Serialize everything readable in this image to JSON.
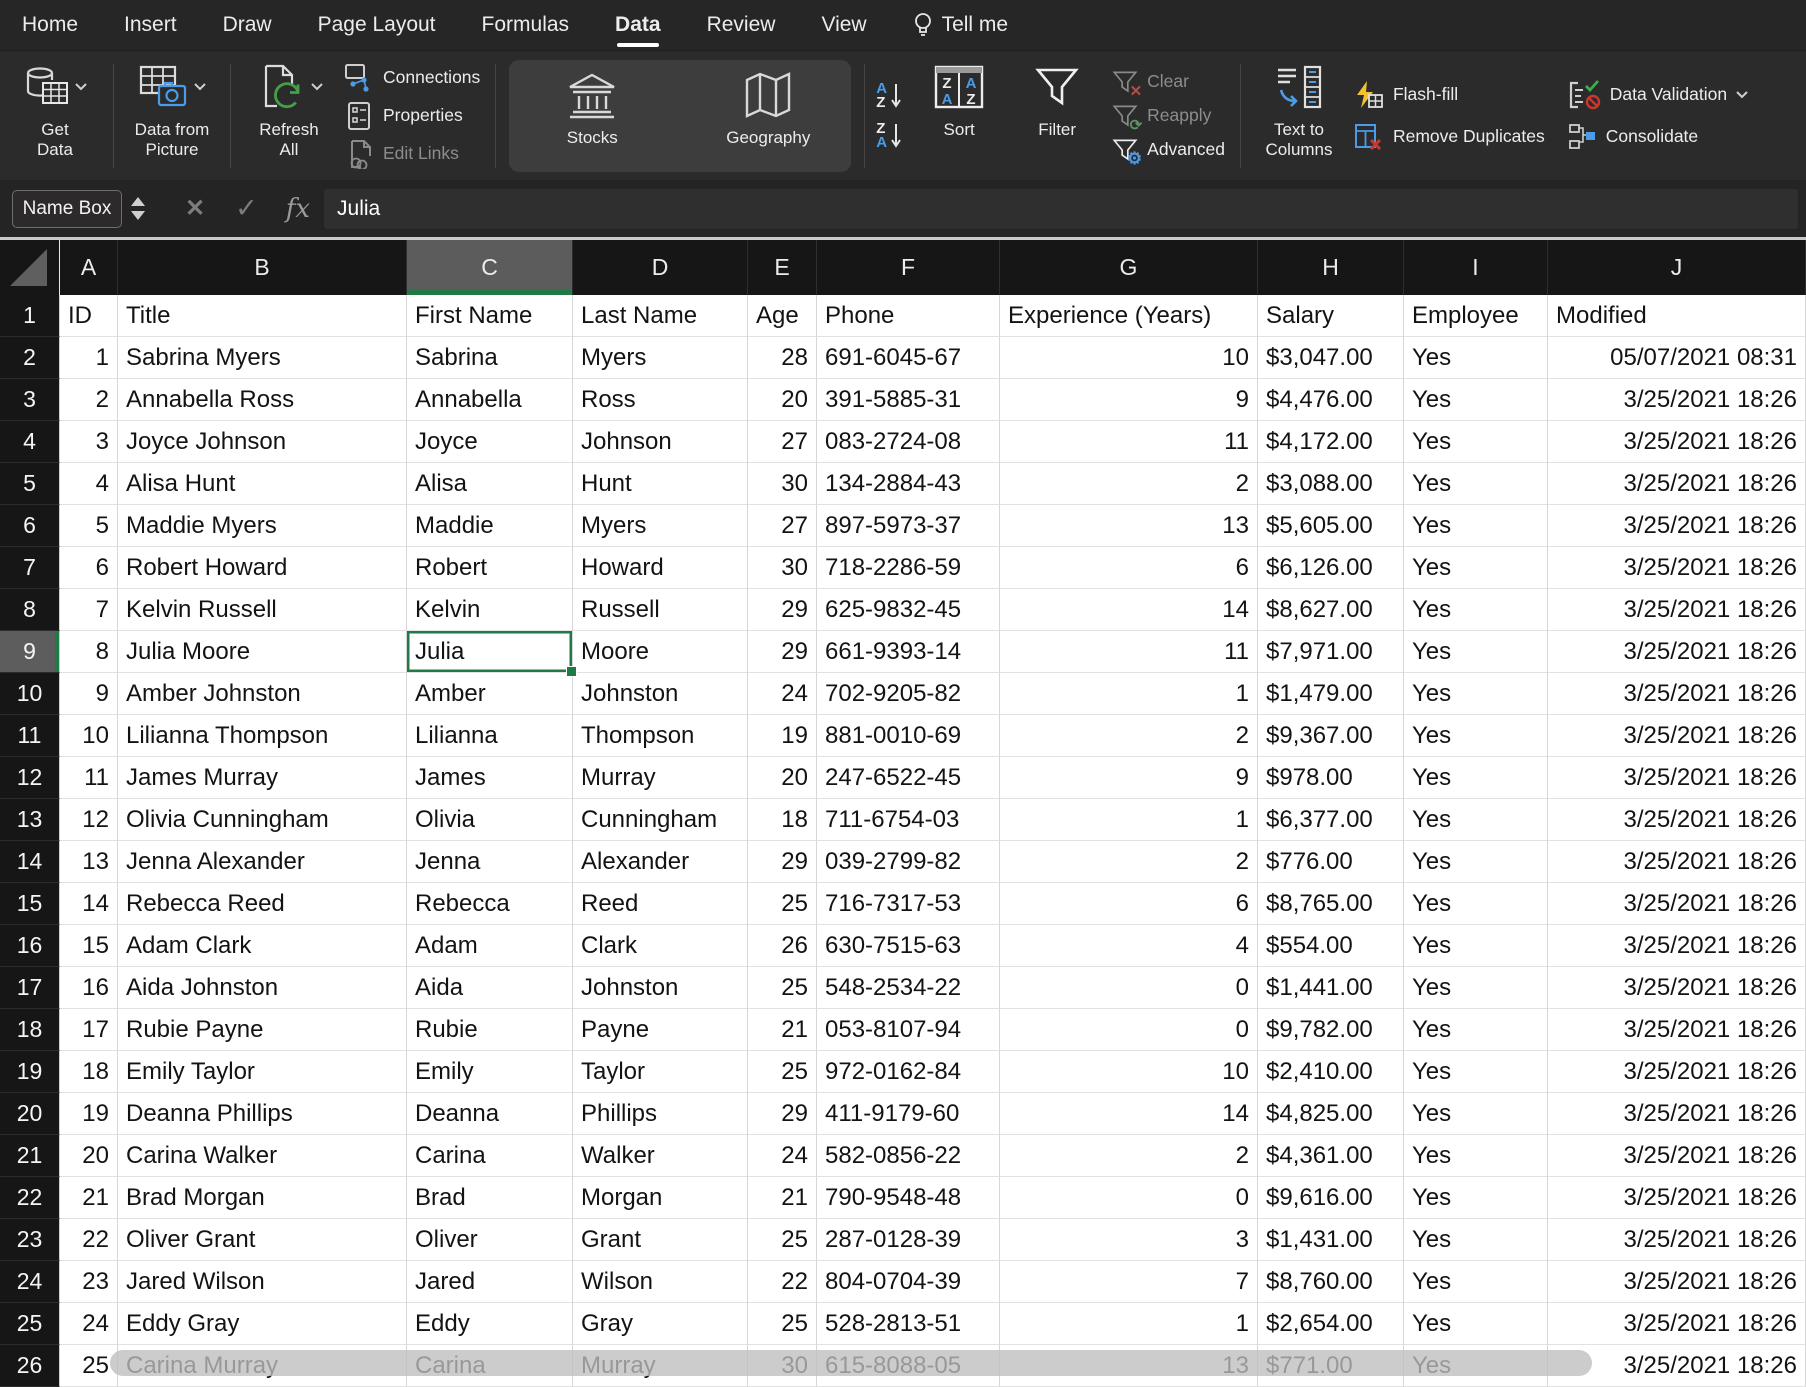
{
  "colors": {
    "accent_green": "#1E7B45",
    "icon_blue": "#4A9BE8",
    "icon_green": "#43A047",
    "icon_red": "#C9382E",
    "icon_yellow": "#F2C12E",
    "header_bg": "#161616",
    "selected_header_bg": "#5C5C5C"
  },
  "menu": {
    "items": [
      {
        "label": "Home"
      },
      {
        "label": "Insert"
      },
      {
        "label": "Draw"
      },
      {
        "label": "Page Layout"
      },
      {
        "label": "Formulas"
      },
      {
        "label": "Data",
        "active": true
      },
      {
        "label": "Review"
      },
      {
        "label": "View"
      },
      {
        "label": "Tell me",
        "icon": "lightbulb"
      }
    ]
  },
  "ribbon": {
    "get_data": "Get\nData",
    "data_from_picture": "Data from\nPicture",
    "refresh_all": "Refresh\nAll",
    "connections": "Connections",
    "properties": "Properties",
    "edit_links": "Edit Links",
    "stocks": "Stocks",
    "geography": "Geography",
    "sort": "Sort",
    "filter": "Filter",
    "clear": "Clear",
    "reapply": "Reapply",
    "advanced": "Advanced",
    "text_to_columns": "Text to\nColumns",
    "flash_fill": "Flash-fill",
    "remove_duplicates": "Remove Duplicates",
    "data_validation": "Data Validation",
    "consolidate": "Consolidate"
  },
  "formula_bar": {
    "name_box": "Name Box",
    "cancel": "✕",
    "confirm": "✓",
    "fx": "fx",
    "value": "Julia"
  },
  "grid": {
    "columns": [
      "A",
      "B",
      "C",
      "D",
      "E",
      "F",
      "G",
      "H",
      "I",
      "J"
    ],
    "field_headers": [
      "ID",
      "Title",
      "First Name",
      "Last Name",
      "Age",
      "Phone",
      "Experience (Years)",
      "Salary",
      "Employee",
      "Modified"
    ],
    "selection": {
      "cell": "C9",
      "column": "C",
      "row_number": 9,
      "value": "Julia"
    },
    "records": [
      [
        "1",
        "Sabrina Myers",
        "Sabrina",
        "Myers",
        "28",
        "691-6045-67",
        "10",
        "$3,047.00",
        "Yes",
        "05/07/2021 08:31"
      ],
      [
        "2",
        "Annabella Ross",
        "Annabella",
        "Ross",
        "20",
        "391-5885-31",
        "9",
        "$4,476.00",
        "Yes",
        "3/25/2021 18:26"
      ],
      [
        "3",
        "Joyce Johnson",
        "Joyce",
        "Johnson",
        "27",
        "083-2724-08",
        "11",
        "$4,172.00",
        "Yes",
        "3/25/2021 18:26"
      ],
      [
        "4",
        "Alisa Hunt",
        "Alisa",
        "Hunt",
        "30",
        "134-2884-43",
        "2",
        "$3,088.00",
        "Yes",
        "3/25/2021 18:26"
      ],
      [
        "5",
        "Maddie Myers",
        "Maddie",
        "Myers",
        "27",
        "897-5973-37",
        "13",
        "$5,605.00",
        "Yes",
        "3/25/2021 18:26"
      ],
      [
        "6",
        "Robert Howard",
        "Robert",
        "Howard",
        "30",
        "718-2286-59",
        "6",
        "$6,126.00",
        "Yes",
        "3/25/2021 18:26"
      ],
      [
        "7",
        "Kelvin Russell",
        "Kelvin",
        "Russell",
        "29",
        "625-9832-45",
        "14",
        "$8,627.00",
        "Yes",
        "3/25/2021 18:26"
      ],
      [
        "8",
        "Julia Moore",
        "Julia",
        "Moore",
        "29",
        "661-9393-14",
        "11",
        "$7,971.00",
        "Yes",
        "3/25/2021 18:26"
      ],
      [
        "9",
        "Amber Johnston",
        "Amber",
        "Johnston",
        "24",
        "702-9205-82",
        "1",
        "$1,479.00",
        "Yes",
        "3/25/2021 18:26"
      ],
      [
        "10",
        "Lilianna Thompson",
        "Lilianna",
        "Thompson",
        "19",
        "881-0010-69",
        "2",
        "$9,367.00",
        "Yes",
        "3/25/2021 18:26"
      ],
      [
        "11",
        "James Murray",
        "James",
        "Murray",
        "20",
        "247-6522-45",
        "9",
        "$978.00",
        "Yes",
        "3/25/2021 18:26"
      ],
      [
        "12",
        "Olivia Cunningham",
        "Olivia",
        "Cunningham",
        "18",
        "711-6754-03",
        "1",
        "$6,377.00",
        "Yes",
        "3/25/2021 18:26"
      ],
      [
        "13",
        "Jenna Alexander",
        "Jenna",
        "Alexander",
        "29",
        "039-2799-82",
        "2",
        "$776.00",
        "Yes",
        "3/25/2021 18:26"
      ],
      [
        "14",
        "Rebecca Reed",
        "Rebecca",
        "Reed",
        "25",
        "716-7317-53",
        "6",
        "$8,765.00",
        "Yes",
        "3/25/2021 18:26"
      ],
      [
        "15",
        "Adam Clark",
        "Adam",
        "Clark",
        "26",
        "630-7515-63",
        "4",
        "$554.00",
        "Yes",
        "3/25/2021 18:26"
      ],
      [
        "16",
        "Aida Johnston",
        "Aida",
        "Johnston",
        "25",
        "548-2534-22",
        "0",
        "$1,441.00",
        "Yes",
        "3/25/2021 18:26"
      ],
      [
        "17",
        "Rubie Payne",
        "Rubie",
        "Payne",
        "21",
        "053-8107-94",
        "0",
        "$9,782.00",
        "Yes",
        "3/25/2021 18:26"
      ],
      [
        "18",
        "Emily Taylor",
        "Emily",
        "Taylor",
        "25",
        "972-0162-84",
        "10",
        "$2,410.00",
        "Yes",
        "3/25/2021 18:26"
      ],
      [
        "19",
        "Deanna Phillips",
        "Deanna",
        "Phillips",
        "29",
        "411-9179-60",
        "14",
        "$4,825.00",
        "Yes",
        "3/25/2021 18:26"
      ],
      [
        "20",
        "Carina Walker",
        "Carina",
        "Walker",
        "24",
        "582-0856-22",
        "2",
        "$4,361.00",
        "Yes",
        "3/25/2021 18:26"
      ],
      [
        "21",
        "Brad Morgan",
        "Brad",
        "Morgan",
        "21",
        "790-9548-48",
        "0",
        "$9,616.00",
        "Yes",
        "3/25/2021 18:26"
      ],
      [
        "22",
        "Oliver Grant",
        "Oliver",
        "Grant",
        "25",
        "287-0128-39",
        "3",
        "$1,431.00",
        "Yes",
        "3/25/2021 18:26"
      ],
      [
        "23",
        "Jared Wilson",
        "Jared",
        "Wilson",
        "22",
        "804-0704-39",
        "7",
        "$8,760.00",
        "Yes",
        "3/25/2021 18:26"
      ],
      [
        "24",
        "Eddy Gray",
        "Eddy",
        "Gray",
        "25",
        "528-2813-51",
        "1",
        "$2,654.00",
        "Yes",
        "3/25/2021 18:26"
      ],
      [
        "25",
        "Carina Murray",
        "Carina",
        "Murray",
        "30",
        "615-8088-05",
        "13",
        "$771.00",
        "Yes",
        "3/25/2021 18:26"
      ]
    ]
  }
}
